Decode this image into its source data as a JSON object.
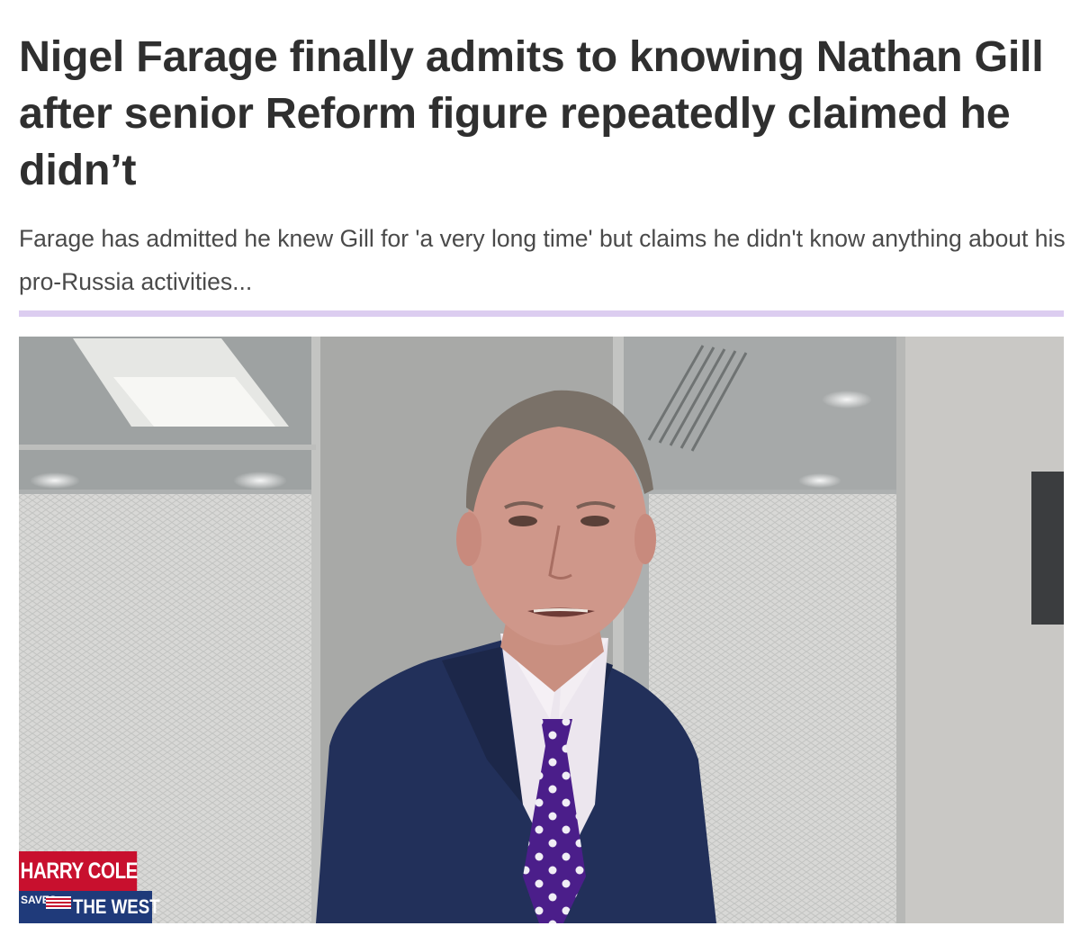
{
  "article": {
    "headline": "Nigel Farage finally admits to knowing Nathan Gill after senior Reform figure repeatedly claimed he didn’t",
    "standfirst": "Farage has admitted he knew Gill for 'a very long time' but claims he didn't know anything about his pro-Russia activities..."
  },
  "photo": {
    "lower_third": {
      "top_text": "HARRY COLE",
      "small_text": "SAVES",
      "main_text": "THE WEST"
    }
  },
  "colors": {
    "headline": "#2f2f2f",
    "standfirst": "#4a4a4a",
    "divider": "#dccdf0",
    "tie": "#4b1e8a",
    "suit": "#22305a",
    "lower_third_red": "#c8102e",
    "lower_third_blue": "#1f3a7a"
  }
}
